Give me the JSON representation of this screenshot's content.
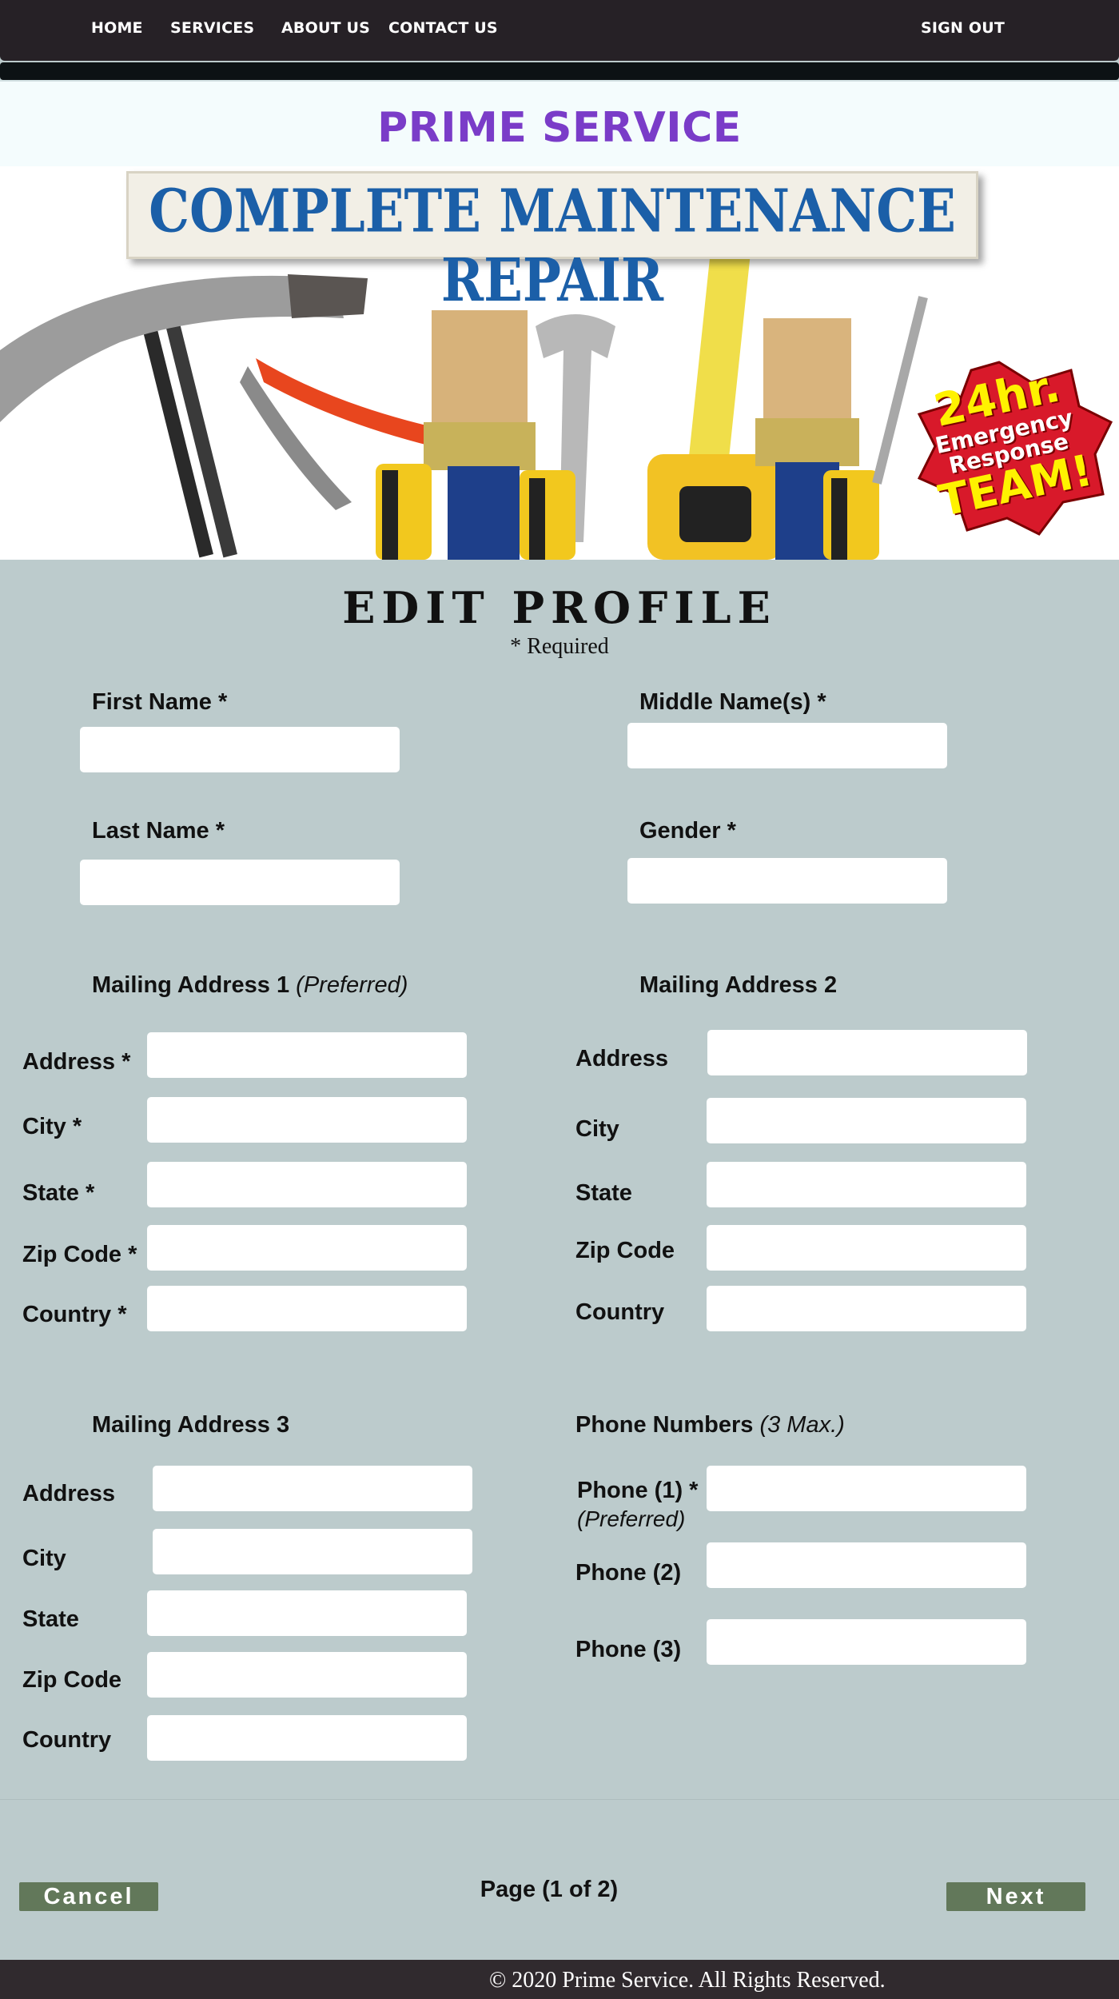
{
  "nav": {
    "items": [
      "HOME",
      "SERVICES",
      "ABOUT US",
      "CONTACT US"
    ],
    "sign_out": "SIGN OUT"
  },
  "brand": {
    "title": "PRIME SERVICE"
  },
  "hero": {
    "sign_text": "COMPLETE MAINTENANCE REPAIR",
    "badge": [
      "24hr.",
      "Emergency",
      "Response",
      "TEAM!"
    ]
  },
  "form": {
    "heading": "EDIT PROFILE",
    "required_note": "* Required",
    "first_name": "First Name *",
    "middle_name": "Middle Name(s) *",
    "last_name": "Last Name *",
    "gender": "Gender *",
    "address1": {
      "title": "Mailing Address 1",
      "title_note": "(Preferred)",
      "address": "Address *",
      "city": "City *",
      "state": "State *",
      "zip": "Zip Code *",
      "country": "Country *"
    },
    "address2": {
      "title": "Mailing Address 2",
      "address": "Address",
      "city": "City",
      "state": "State",
      "zip": "Zip Code",
      "country": "Country"
    },
    "address3": {
      "title": "Mailing Address 3",
      "address": "Address",
      "city": "City",
      "state": "State",
      "zip": "Zip Code",
      "country": "Country"
    },
    "phones": {
      "title": "Phone Numbers",
      "title_note": "(3 Max.)",
      "phone1": "Phone (1) *",
      "phone1_note": "(Preferred)",
      "phone2": "Phone (2)",
      "phone3": "Phone (3)"
    }
  },
  "controls": {
    "cancel": "Cancel",
    "next": "Next",
    "page_indicator": "Page (1 of 2)"
  },
  "footer": {
    "copyright": "© 2020 Prime Service. All Rights Reserved."
  },
  "colors": {
    "nav_bg": "#262126",
    "brand_title": "#7a3cc8",
    "form_bg": "#bccbcc",
    "button_bg": "#62785a",
    "footer_bg": "#302a2e"
  }
}
